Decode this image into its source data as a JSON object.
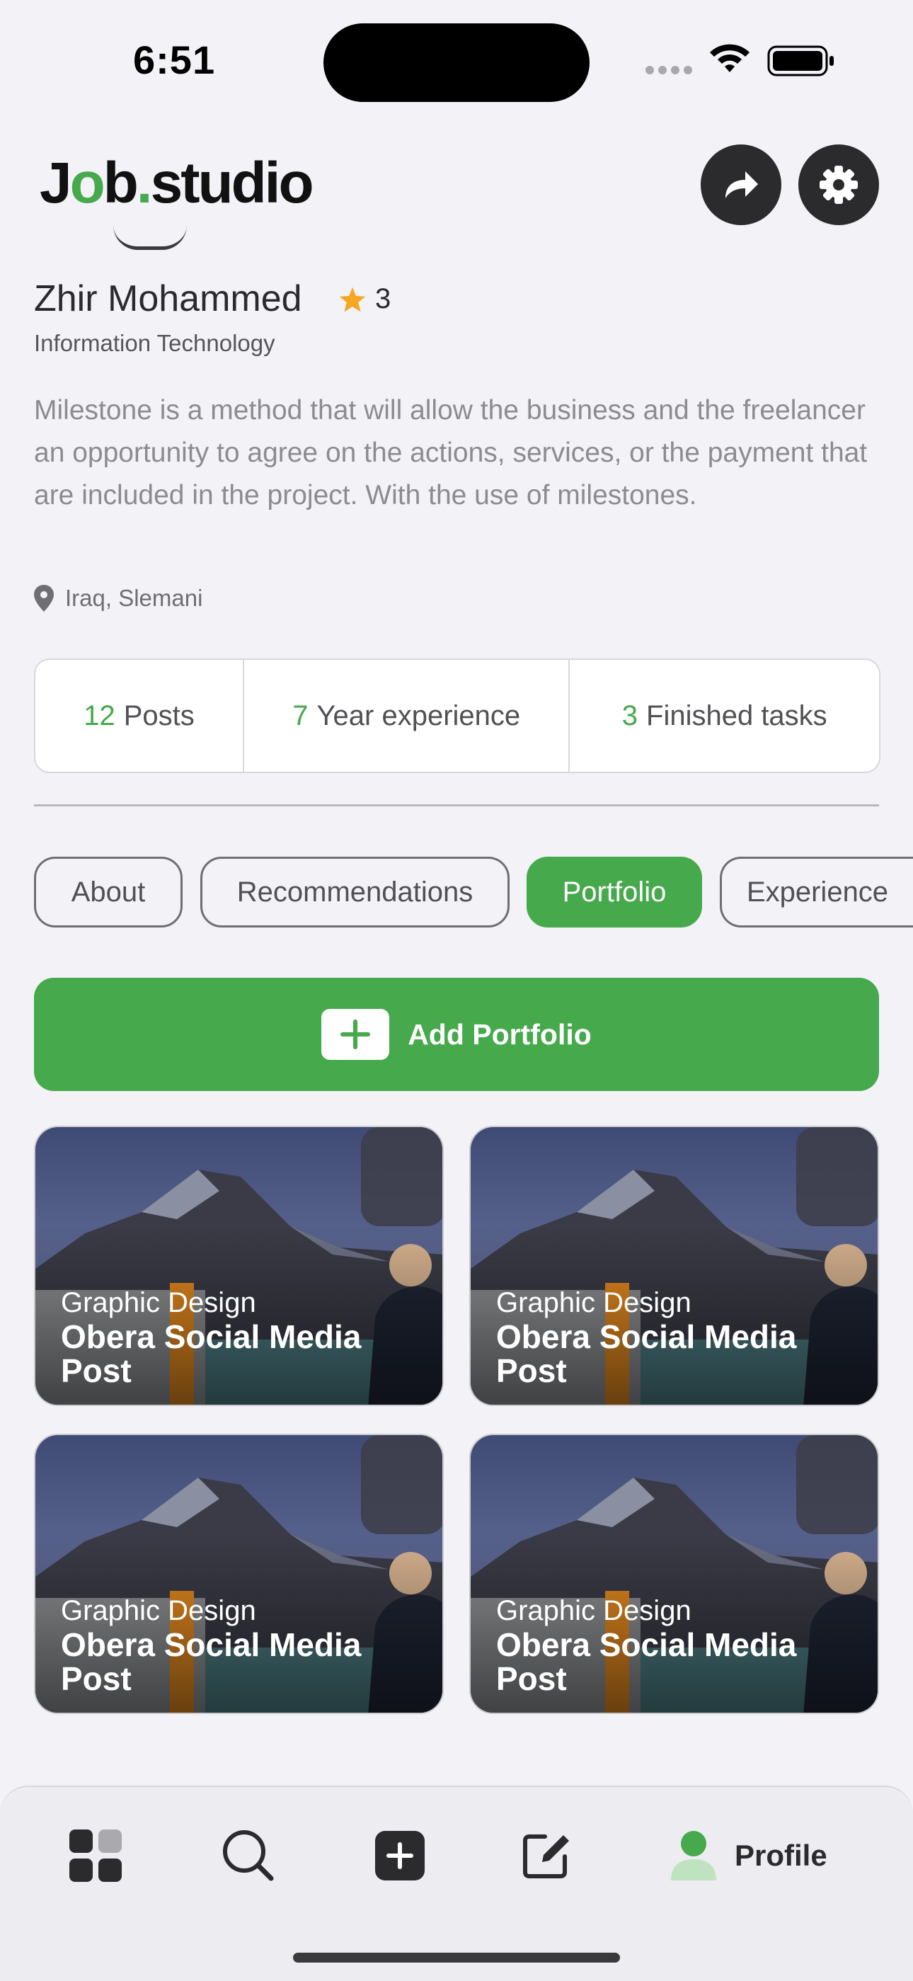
{
  "status_bar": {
    "time": "6:51"
  },
  "header": {
    "logo_part1": "J",
    "logo_part2": "o",
    "logo_part3": "b",
    "logo_part4": ".",
    "logo_part5": "studio",
    "share_icon": "share-arrow-icon",
    "settings_icon": "gear-icon"
  },
  "profile": {
    "name": "Zhir Mohammed",
    "rating": "3",
    "role": "Information Technology",
    "bio": "Milestone is a method that will allow the business and the freelancer an opportunity to agree on the actions, services, or the payment that are included in the project. With the use of milestones.",
    "location": "Iraq, Slemani"
  },
  "stats": [
    {
      "value": "12",
      "label": "Posts"
    },
    {
      "value": "7",
      "label": "Year experience"
    },
    {
      "value": "3",
      "label": "Finished tasks"
    }
  ],
  "tabs": [
    {
      "label": "About",
      "active": false
    },
    {
      "label": "Recommendations",
      "active": false
    },
    {
      "label": "Portfolio",
      "active": true
    },
    {
      "label": "Experience",
      "active": false
    }
  ],
  "add_portfolio": {
    "label": "Add Portfolio"
  },
  "portfolio": [
    {
      "category": "Graphic Design",
      "title": "Obera Social Media Post"
    },
    {
      "category": "Graphic Design",
      "title": "Obera Social Media Post"
    },
    {
      "category": "Graphic Design",
      "title": "Obera Social Media Post"
    },
    {
      "category": "Graphic Design",
      "title": "Obera Social Media Post"
    }
  ],
  "bottom_nav": {
    "items": [
      "dashboard-icon",
      "search-icon",
      "add-icon",
      "edit-icon",
      "profile-icon"
    ],
    "active_label": "Profile"
  },
  "colors": {
    "accent": "#46a94c",
    "star": "#f5a623",
    "dark": "#2b2b2e"
  }
}
